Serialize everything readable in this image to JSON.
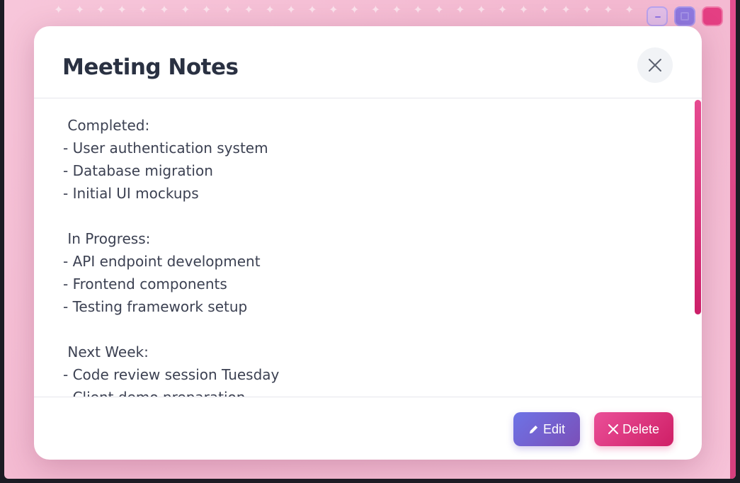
{
  "window": {
    "decoration": "✦ ✦ ✦ ✦ ✦ ✦ ✦ ✦ ✦ ✦ ✦ ✦ ✦ ✦ ✦ ✦ ✦ ✦ ✦ ✦ ✦ ✦ ✦ ✦ ✦ ✦ ✦ ✦ ✦ ✦ ✦ ✦ ✦ ✦ ✦ ✦ ✦ ✦ ✦ ✦",
    "controls": [
      "minimize",
      "maximize",
      "close"
    ]
  },
  "modal": {
    "title": "Meeting Notes",
    "lines": [
      " Completed:",
      "- User authentication system",
      "- Database migration",
      "- Initial UI mockups",
      "",
      " In Progress:",
      "- API endpoint development",
      "- Frontend components",
      "- Testing framework setup",
      "",
      " Next Week:",
      "- Code review session Tuesday",
      "- Client demo preparation"
    ],
    "footer": {
      "edit_label": "Edit",
      "delete_label": "Delete"
    }
  },
  "colors": {
    "accent_pink": "#e0337a",
    "accent_purple": "#6d73e6",
    "title_text": "#2a3142",
    "body_text": "#3c4152"
  },
  "icons": {
    "edit": "pencil-icon",
    "delete": "x-icon",
    "close": "close-icon"
  }
}
